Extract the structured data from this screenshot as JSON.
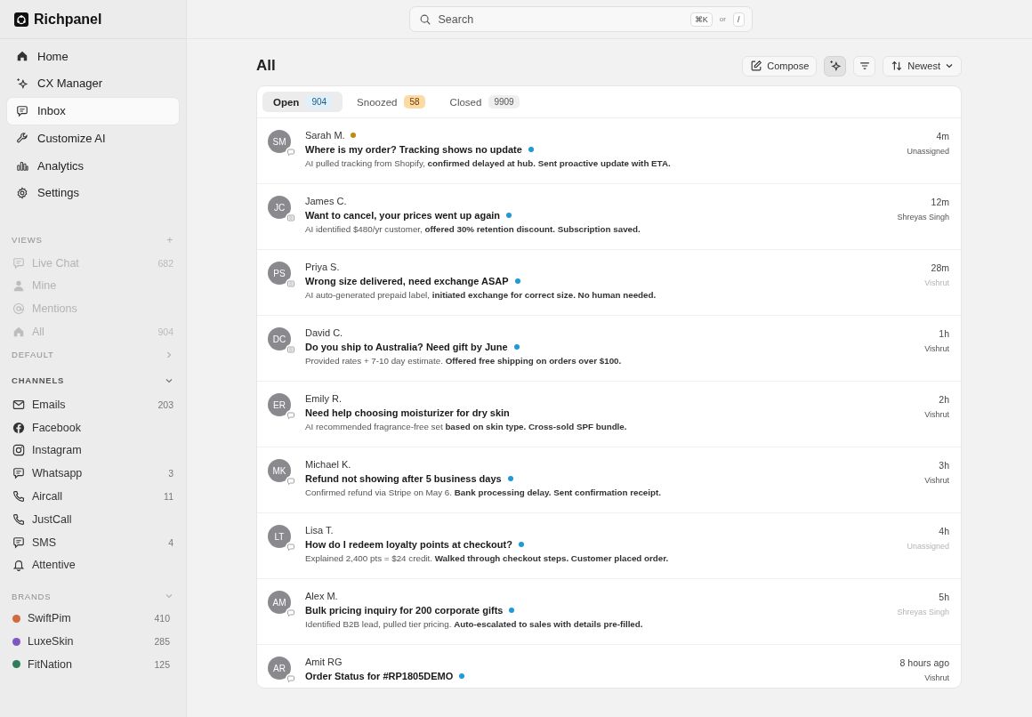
{
  "brand": {
    "name": "Richpanel"
  },
  "search": {
    "placeholder": "Search",
    "shortcut": "⌘K",
    "or": "or",
    "alt_shortcut": "/"
  },
  "nav": [
    {
      "label": "Home",
      "kind": "home",
      "selected": false
    },
    {
      "label": "CX Manager",
      "kind": "sparkle",
      "selected": false
    },
    {
      "label": "Inbox",
      "kind": "chat",
      "selected": true
    },
    {
      "label": "Customize AI",
      "kind": "wrench",
      "selected": false
    },
    {
      "label": "Analytics",
      "kind": "bars",
      "selected": false
    },
    {
      "label": "Settings",
      "kind": "gear",
      "selected": false
    }
  ],
  "views": {
    "title": "VIEWS",
    "add": "+",
    "disabled": true,
    "items": [
      {
        "label": "Live Chat",
        "kind": "chat",
        "count": "682"
      },
      {
        "label": "Mine",
        "kind": "person"
      },
      {
        "label": "Mentions",
        "kind": "at"
      },
      {
        "label": "All",
        "kind": "home",
        "count": "904"
      }
    ]
  },
  "default_section": {
    "title": "DEFAULT",
    "expanded": false
  },
  "channels": {
    "title": "CHANNELS",
    "expanded": true,
    "items": [
      {
        "label": "Emails",
        "kind": "mail",
        "count": "203"
      },
      {
        "label": "Facebook",
        "kind": "facebook"
      },
      {
        "label": "Instagram",
        "kind": "instagram"
      },
      {
        "label": "Whatsapp",
        "kind": "chat",
        "count": "3"
      },
      {
        "label": "Aircall",
        "kind": "phone",
        "count": "11"
      },
      {
        "label": "JustCall",
        "kind": "phone"
      },
      {
        "label": "SMS",
        "kind": "chat",
        "count": "4"
      },
      {
        "label": "Attentive",
        "kind": "bell"
      }
    ]
  },
  "brands": {
    "title": "BRANDS",
    "expanded": true,
    "items": [
      {
        "label": "SwiftPim",
        "count": "410",
        "color": "#d2693f"
      },
      {
        "label": "LuxeSkin",
        "count": "285",
        "color": "#7e57c2"
      },
      {
        "label": "FitNation",
        "count": "125",
        "color": "#2e7d5b"
      }
    ]
  },
  "page": {
    "title": "All",
    "compose": "Compose",
    "sort": "Newest",
    "ai_toggle": {
      "on": true
    }
  },
  "tabs": [
    {
      "label": "Open",
      "count": "904",
      "selected": true,
      "kind": "info"
    },
    {
      "label": "Snoozed",
      "count": "58",
      "selected": false,
      "kind": "warning"
    },
    {
      "label": "Closed",
      "count": "9909",
      "selected": false,
      "kind": "neutral"
    }
  ],
  "conversations": [
    {
      "initials": "SM",
      "kind": "chat",
      "name": "Sarah M.",
      "color": "#c08a10",
      "subject": "Where is my order? Tracking shows no update",
      "unread": true,
      "preview": "AI pulled tracking from Shopify, **confirmed delayed at hub. Sent proactive update with ETA.**",
      "time": "4m",
      "assignee": "Unassigned",
      "assignee_muted": false
    },
    {
      "initials": "JC",
      "kind": "email",
      "name": "James C.",
      "subject": "Want to cancel, your prices went up again",
      "unread": true,
      "preview": "AI identified $480/yr customer, **offered 30% retention discount. Subscription saved.**",
      "time": "12m",
      "assignee": "Shreyas Singh",
      "assignee_muted": false
    },
    {
      "initials": "PS",
      "kind": "email",
      "name": "Priya S.",
      "subject": "Wrong size delivered, need exchange ASAP",
      "unread": true,
      "preview": "AI auto-generated prepaid label, **initiated exchange for correct size. No human needed.**",
      "time": "28m",
      "assignee": "Vishrut",
      "assignee_muted": true
    },
    {
      "initials": "DC",
      "kind": "email",
      "name": "David C.",
      "subject": "Do you ship to Australia? Need gift by June",
      "unread": true,
      "preview": "Provided rates + 7-10 day estimate. **Offered free shipping on orders over $100.**",
      "time": "1h",
      "assignee": "Vishrut",
      "assignee_muted": false
    },
    {
      "initials": "ER",
      "kind": "chat",
      "name": "Emily R.",
      "subject": "Need help choosing moisturizer for dry skin",
      "unread": false,
      "preview": "AI recommended fragrance-free set **based on skin type. Cross-sold SPF bundle.**",
      "time": "2h",
      "assignee": "Vishrut",
      "assignee_muted": false
    },
    {
      "initials": "MK",
      "kind": "chat",
      "name": "Michael K.",
      "subject": "Refund not showing after 5 business days",
      "unread": true,
      "preview": "Confirmed refund via Stripe on May 6. **Bank processing delay. Sent confirmation receipt.**",
      "time": "3h",
      "assignee": "Vishrut",
      "assignee_muted": false
    },
    {
      "initials": "LT",
      "kind": "chat",
      "name": "Lisa T.",
      "subject": "How do I redeem loyalty points at checkout?",
      "unread": true,
      "preview": "Explained 2,400 pts = $24 credit. **Walked through checkout steps. Customer placed order.**",
      "time": "4h",
      "assignee": "Unassigned",
      "assignee_muted": true
    },
    {
      "initials": "AM",
      "kind": "chat",
      "name": "Alex M.",
      "subject": "Bulk pricing inquiry for 200 corporate gifts",
      "unread": true,
      "preview": "Identified B2B lead, pulled tier pricing. **Auto-escalated to sales with details pre-filled.**",
      "time": "5h",
      "assignee": "Shreyas Singh",
      "assignee_muted": true
    },
    {
      "initials": "AR",
      "kind": "chat",
      "name": "Amit RG",
      "subject": "Order Status for #RP1805DEMO",
      "unread": true,
      "time": "8 hours ago",
      "assignee": "Vishrut",
      "assignee_muted": false
    }
  ]
}
